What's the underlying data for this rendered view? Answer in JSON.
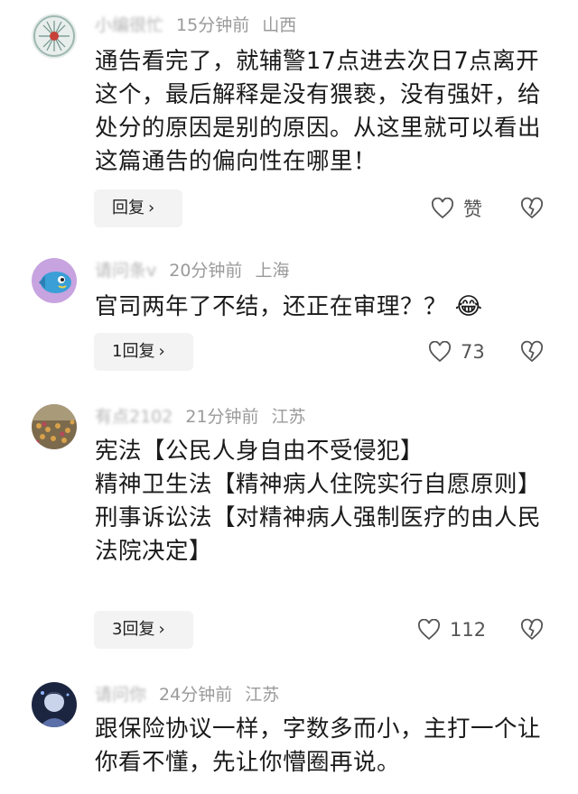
{
  "comments": [
    {
      "user": "小编很忙",
      "time": "15分钟前",
      "location": "山西",
      "text": "通告看完了，就辅警17点进去次日7点离开这个，最后解释是没有猥亵，没有强奸，给处分的原因是别的原因。从这里就可以看出这篇通告的偏向性在哪里！",
      "reply_label": "回复",
      "like_label": "赞"
    },
    {
      "user": "请问条v",
      "time": "20分钟前",
      "location": "上海",
      "text": "官司两年了不结，还正在审理？？",
      "emoji": "😂",
      "reply_label": "1回复",
      "like_label": "73"
    },
    {
      "user": "有点2102",
      "time": "21分钟前",
      "location": "江苏",
      "lines": [
        "宪法【公民人身自由不受侵犯】",
        "精神卫生法【精神病人住院实行自愿原则】",
        "刑事诉讼法【对精神病人强制医疗的由人民法院决定】"
      ],
      "reply_label": "3回复",
      "like_label": "112"
    },
    {
      "user": "请问你",
      "time": "24分钟前",
      "location": "江苏",
      "text": "跟保险协议一样，字数多而小，主打一个让你看不懂，先让你懵圈再说。"
    }
  ],
  "icons": {
    "chevron": "›",
    "heart": "heart-icon",
    "dislike": "broken-heart-icon"
  }
}
